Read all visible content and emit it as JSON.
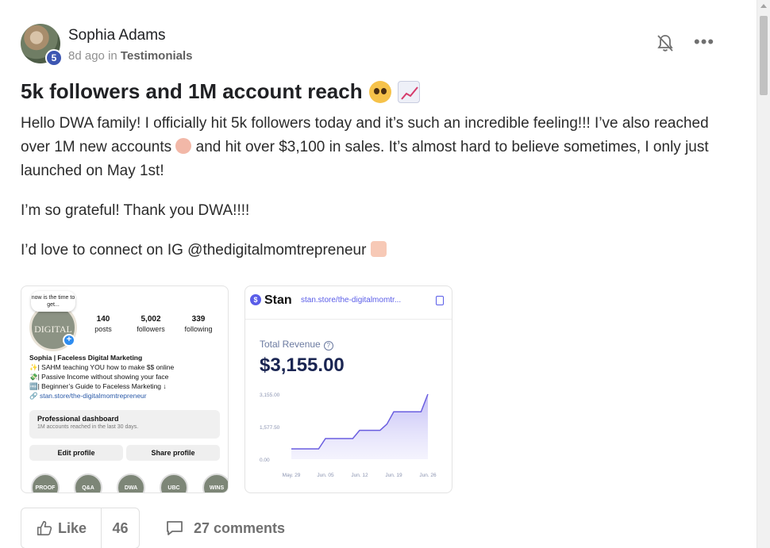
{
  "post": {
    "author": "Sophia Adams",
    "level": "5",
    "time_ago": "8d ago",
    "in_word": "in",
    "category": "Testimonials",
    "title": "5k followers and 1M account reach",
    "paragraphs": {
      "p1_a": "Hello DWA family! I officially hit 5k followers today and it’s such an incredible feeling!!! I’ve also reached over 1M new accounts",
      "p1_b": "and hit over $3,100 in sales. It’s almost hard to believe sometimes, I only just launched on May 1st!",
      "p2": "I’m so grateful! Thank you DWA!!!!",
      "p3": "I’d love to connect on IG @thedigitalmomtrepreneur"
    },
    "icons": {
      "bell": "bell-muted-icon",
      "more": "more-options-icon",
      "title_emoji_1": "pleading-face-emoji",
      "title_emoji_2": "chart-increasing-emoji",
      "celebrate": "partying-face-emoji",
      "heart_hands": "heart-hands-emoji",
      "like": "thumbs-up-icon",
      "comment": "comment-icon"
    }
  },
  "instagram": {
    "bubble": "now is the time to get...",
    "logo_text": "DIGITAL",
    "stats": [
      {
        "num": "140",
        "label": "posts"
      },
      {
        "num": "5,002",
        "label": "followers"
      },
      {
        "num": "339",
        "label": "following"
      }
    ],
    "bio_name": "Sophia | Faceless Digital Marketing",
    "bio_lines": [
      "✨| SAHM teaching YOU how to make $$ online",
      "💸| Passive Income without showing your face",
      "🆓| Beginner’s Guide to Faceless Marketing ↓"
    ],
    "bio_link": "stan.store/the-digitalmomtrepreneur",
    "dashboard_title": "Professional dashboard",
    "dashboard_sub": "1M accounts reached in the last 30 days.",
    "edit_profile": "Edit profile",
    "share_profile": "Share profile",
    "highlights": [
      "PROOF",
      "Q&A",
      "DWA",
      "UBC",
      "WINS"
    ]
  },
  "stan": {
    "brand": "Stan",
    "url": "stan.store/the-digitalmomtr...",
    "revenue_label": "Total Revenue",
    "revenue_value": "$3,155.00"
  },
  "chart_data": {
    "type": "area",
    "x_labels": [
      "May. 29",
      "Jun. 05",
      "Jun. 12",
      "Jun. 19",
      "Jun. 26"
    ],
    "y_ticks": [
      "3,155.00",
      "1,577.50",
      "0.00"
    ],
    "ylim": [
      0,
      3155
    ],
    "x": [
      0,
      0.8,
      1.0,
      1.8,
      2.0,
      2.6,
      2.8,
      3.0,
      3.8,
      4.0
    ],
    "values": [
      500,
      500,
      1000,
      1000,
      1400,
      1400,
      1700,
      2300,
      2300,
      3155
    ]
  },
  "actions": {
    "like_label": "Like",
    "like_count": "46",
    "comments_label": "27 comments"
  }
}
